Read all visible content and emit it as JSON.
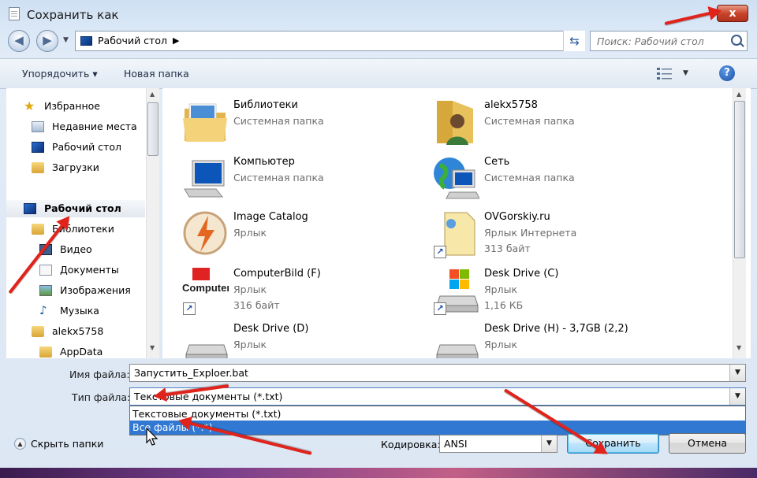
{
  "window": {
    "title": "Сохранить как",
    "close_label": "x"
  },
  "address": {
    "location": "Рабочий стол",
    "separator": "▶"
  },
  "search": {
    "placeholder": "Поиск: Рабочий стол"
  },
  "toolbar": {
    "organize_label": "Упорядочить ▾",
    "new_folder_label": "Новая папка",
    "help_label": "?"
  },
  "nav": {
    "items": [
      {
        "label": "Избранное",
        "icon": "star-icon"
      },
      {
        "label": "Недавние места",
        "icon": "recent-places-icon"
      },
      {
        "label": "Рабочий стол",
        "icon": "desktop-icon"
      },
      {
        "label": "Загрузки",
        "icon": "downloads-folder-icon"
      },
      {
        "label": "Рабочий стол",
        "icon": "desktop-icon"
      },
      {
        "label": "Библиотеки",
        "icon": "libraries-icon"
      },
      {
        "label": "Видео",
        "icon": "video-library-icon"
      },
      {
        "label": "Документы",
        "icon": "documents-library-icon"
      },
      {
        "label": "Изображения",
        "icon": "pictures-library-icon"
      },
      {
        "label": "Музыка",
        "icon": "music-library-icon"
      },
      {
        "label": "alekx5758",
        "icon": "user-folder-icon"
      },
      {
        "label": "AppData",
        "icon": "folder-icon"
      }
    ]
  },
  "files": [
    {
      "name": "Библиотеки",
      "type": "Системная папка",
      "size": "",
      "icon": "libraries-folder-icon"
    },
    {
      "name": "alekx5758",
      "type": "Системная папка",
      "size": "",
      "icon": "user-folder-icon"
    },
    {
      "name": "Компьютер",
      "type": "Системная папка",
      "size": "",
      "icon": "computer-icon"
    },
    {
      "name": "Сеть",
      "type": "Системная папка",
      "size": "",
      "icon": "network-globe-icon"
    },
    {
      "name": "Image Catalog",
      "type": "Ярлык",
      "size": "",
      "icon": "image-catalog-icon"
    },
    {
      "name": "OVGorskiy.ru",
      "type": "Ярлык Интернета",
      "size": "313 байт",
      "icon": "internet-shortcut-icon"
    },
    {
      "name": "ComputerBild (F)",
      "type": "Ярлык",
      "size": "316 байт",
      "icon": "computerbild-icon"
    },
    {
      "name": "Desk Drive (C)",
      "type": "Ярлык",
      "size": "1,16 КБ",
      "icon": "drive-shortcut-icon"
    },
    {
      "name": "Desk Drive (D)",
      "type": "Ярлык",
      "size": "",
      "icon": "drive-shortcut-icon"
    },
    {
      "name": "Desk Drive (H) - 3,7GB (2,2)",
      "type": "Ярлык",
      "size": "",
      "icon": "drive-shortcut-icon"
    }
  ],
  "form": {
    "filename_label": "Имя файла:",
    "filename_value": "Запустить_Exploer.bat",
    "filetype_label": "Тип файла:",
    "filetype_value": "Текстовые документы (*.txt)",
    "filetype_options": [
      "Текстовые документы (*.txt)",
      "Все файлы (*.*)"
    ],
    "selected_option_index": 1,
    "encoding_label": "Кодировка:",
    "encoding_value": "ANSI"
  },
  "footer": {
    "hide_folders_label": "Скрыть папки",
    "save_label": "Сохранить",
    "cancel_label": "Отмена"
  },
  "colors": {
    "arrow": "#e0231b",
    "selection": "#3178d3",
    "secondary_text": "#6d6d6d"
  }
}
